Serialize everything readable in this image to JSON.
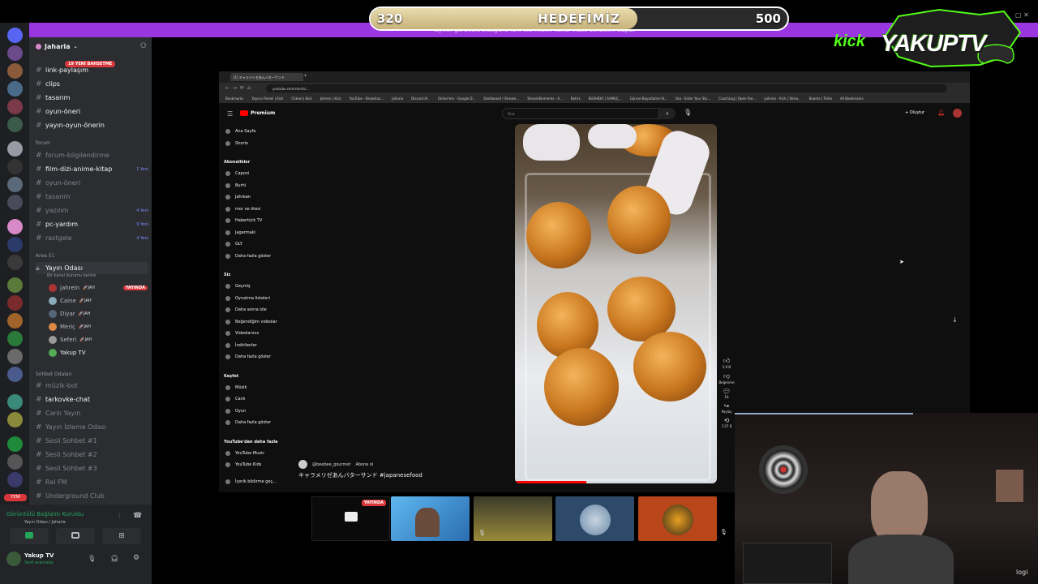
{
  "goal": {
    "current": "320",
    "title": "HEDEFİMİZ",
    "target": "500",
    "progress": 0.64
  },
  "banner": {
    "text": "Yayının gürültülü olduğunu fark etti misin? Kendi video sohbetini başlat"
  },
  "logo": {
    "kick": "kick",
    "name": "YAKUPTV"
  },
  "discord": {
    "server_name": "Jaharia",
    "new_badge": "19 YENİ BAHSETME",
    "channels_top": [
      {
        "name": "link-paylaşım",
        "bright": true
      },
      {
        "name": "clips",
        "bright": true
      },
      {
        "name": "tasarım",
        "bright": true
      },
      {
        "name": "oyun-önerі",
        "bright": true
      },
      {
        "name": "yayın-oyun-önerin",
        "bright": true
      }
    ],
    "cat_forum": "forum",
    "forum_channels": [
      {
        "name": "forum-bilgilendirme",
        "bright": false,
        "count": ""
      },
      {
        "name": "film-dizi-anime-kitap",
        "bright": true,
        "count": "1 Yeni"
      },
      {
        "name": "oyun-öneri",
        "bright": false,
        "count": ""
      },
      {
        "name": "tasarım",
        "bright": false,
        "count": ""
      },
      {
        "name": "yazılım",
        "bright": false,
        "count": "4 Yeni"
      },
      {
        "name": "pc-yardım",
        "bright": true,
        "count": "9 Yeni"
      },
      {
        "name": "rastgele",
        "bright": false,
        "count": "4 Yeni"
      }
    ],
    "cat_area": "Area 51",
    "voice_room": "Yayın Odası",
    "voice_sub": "Bir kanal durumu belirle",
    "live_badge": "YAYINDA",
    "members": [
      {
        "name": "jahrein",
        "tag": "JAH",
        "color": "#b5bac1"
      },
      {
        "name": "Caine",
        "tag": "JAH",
        "color": "#b5bac1"
      },
      {
        "name": "Diyar",
        "tag": "JAH",
        "color": "#b5bac1"
      },
      {
        "name": "Meriç",
        "tag": "JAH",
        "color": "#b5bac1"
      },
      {
        "name": "Seferi",
        "tag": "JAH",
        "color": "#b5bac1"
      },
      {
        "name": "Yakup TV",
        "tag": "",
        "color": "#f2f3f5"
      }
    ],
    "cat_chat": "Sohbet Odaları",
    "chat_channels": [
      {
        "name": "müzik-bot",
        "bright": false
      },
      {
        "name": "tarkovke-chat",
        "bright": true
      },
      {
        "name": "Canlı Yayın",
        "bright": false
      },
      {
        "name": "Yayın İzleme Odası",
        "bright": false
      },
      {
        "name": "Sesli Sohbet #1",
        "bright": false
      },
      {
        "name": "Sesli Sohbet #2",
        "bright": false
      },
      {
        "name": "Sesli Sohbet #3",
        "bright": false
      },
      {
        "name": "Ral FM",
        "bright": false
      },
      {
        "name": "Underground Club",
        "bright": false
      }
    ],
    "connection_title": "Görüntülü Bağlantı Kuruldu",
    "connection_sub": "Yayın Odası / Jaharia",
    "user_name": "Yakup TV",
    "user_status": "Sesli aramada",
    "new_label": "YENİ"
  },
  "browser": {
    "tab_title": "(1) キャラメリゼあんバターサンド",
    "url": "youtube.com/shorts/...",
    "bookmarks": [
      "Bookmarks",
      "Yayıncı Paneli | Kick",
      "Cöksel | Kick",
      "Jahrein | Kick",
      "YouTube - Broadcas...",
      "Jaharia",
      "Discord Al..",
      "Online'em - Google D...",
      "Dashboard / Stream...",
      "StreamElements - A...",
      "Botrix",
      "BUSHIDO | SAMUÇ...",
      "Güncel Boyutlamın N...",
      "Vaa - Enter Your Stu...",
      "CouchLog | Open the...",
      "yahrein - Kick | Strea...",
      "Boards | Trello",
      "All Bookmarks"
    ],
    "yt_logo": "Premium",
    "search_placeholder": "Ara",
    "create_label": "Oluştur",
    "side_main": [
      "Ana Sayfa",
      "Shorts"
    ],
    "subs_header": "Abonelikler",
    "subs": [
      "Caponi",
      "Burhi",
      "Jahrean",
      "mor ve ötesi",
      "Habertürk TV",
      "Jagermaki",
      "GLY",
      "Daha fazla göster"
    ],
    "you_header": "Siz",
    "you_items": [
      "Geçmiş",
      "Oynatma listeleri",
      "Daha sonra izle",
      "Beğendiğim videolar",
      "Videolarınız",
      "İndirilenler",
      "Daha fazla göster"
    ],
    "explore_header": "Keşfet",
    "explore_items": [
      "Müzik",
      "Canlı",
      "Oyun",
      "Daha fazla göster"
    ],
    "more_header": "YouTube'dan daha fazla",
    "more_items": [
      "YouTube Music",
      "YouTube Kids"
    ],
    "bottom": "İçerik bildirme geç...",
    "channel_handle": "@beebee_gourmet",
    "subscribe": "Abone ol",
    "caption": "キャラメリゼあんバターサンド #japanesefood",
    "actions": [
      "2,9 B",
      "Beğenme",
      "16",
      "Paylaş",
      "7,07 B"
    ]
  },
  "thumbs": {
    "live": "YAYINDA"
  },
  "watermark": "logi"
}
